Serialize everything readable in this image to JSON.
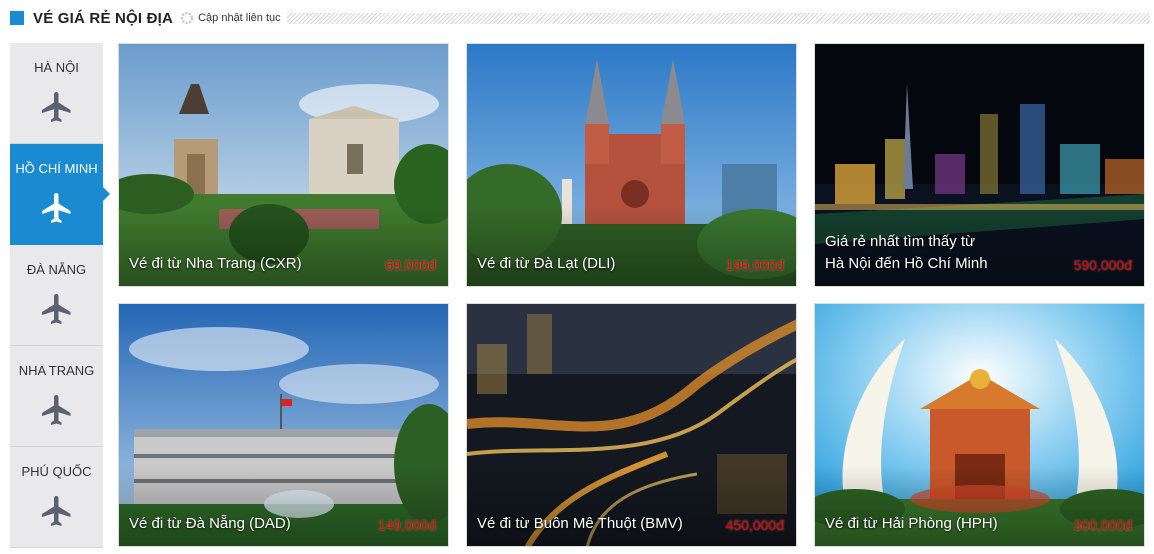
{
  "header": {
    "title": "VÉ GIÁ RẺ NỘI ĐỊA",
    "update_text": "Cập nhật liên tục",
    "accent_color": "#1a8bd1"
  },
  "sidebar": {
    "active_index": 1,
    "items": [
      {
        "label": "HÀ NỘI",
        "icon": "airplane-icon"
      },
      {
        "label": "HỒ CHÍ MINH",
        "icon": "airplane-icon"
      },
      {
        "label": "ĐÀ NẴNG",
        "icon": "airplane-icon"
      },
      {
        "label": "NHA TRANG",
        "icon": "airplane-icon"
      },
      {
        "label": "PHÚ QUỐC",
        "icon": "airplane-icon"
      }
    ]
  },
  "deals": [
    {
      "caption": "Vé đi từ Nha Trang (CXR)",
      "price": "69,000đ"
    },
    {
      "caption": "Vé đi từ Đà Lạt (DLI)",
      "price": "199,000đ"
    },
    {
      "caption_line1": "Giá rẻ nhất tìm thấy từ",
      "caption_line2": "Hà Nội đến Hồ Chí Minh",
      "price": "590,000đ"
    },
    {
      "caption": "Vé đi từ Đà Nẵng (DAD)",
      "price": "149,000đ"
    },
    {
      "caption": "Vé đi từ Buôn Mê Thuột (BMV)",
      "price": "450,000đ"
    },
    {
      "caption": "Vé đi từ Hải Phòng (HPH)",
      "price": "300,000đ"
    }
  ],
  "price_color": "#e80000"
}
